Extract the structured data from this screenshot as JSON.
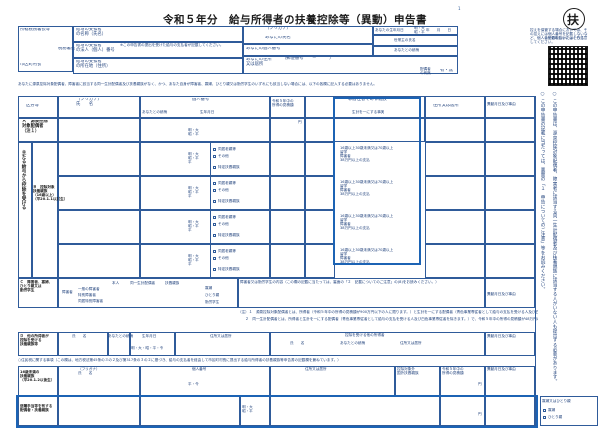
{
  "header": {
    "title": "令和５年分　給与所得者の扶養控除等（異動）申告書",
    "page_no": "1",
    "circle_badge": "扶"
  },
  "employer": {
    "tax_office": "所轄税務署長等",
    "office_suffix": "税務署長",
    "city_suffix": "市区町村長",
    "payer_name": "給与の支払者\nの名称（氏名）",
    "payer_number": "給与の支払者\nの法人（個人）番号",
    "payer_address": "給与の支払者\nの所在地（住所）",
    "number_note": "※この申告書の提出を受けた給与の支払者が記載してください。"
  },
  "applicant": {
    "kana_label": "（フリガナ）",
    "name_label": "あなたの氏名",
    "number_label": "あなたの個人番号",
    "address_label": "あなたの住所\n又は居所",
    "postal_label": "（郵便番号　　－　　　）",
    "birth_label": "あなたの生年月日",
    "birth_value": "明・大\n昭・平",
    "birth_ymd": "年　　月　　日",
    "householder_label": "世帯主の氏名",
    "relation_label": "あなたとの続柄",
    "spouse_label": "配偶者\nの有無",
    "spouse_value": "有・無"
  },
  "notice": "あなたに源泉控除対象配偶者、障害者に該当する同一生計配偶者及び扶養親族がなく、かつ、あなた自身が障害者、寡婦、ひとり親又は勤労学生のいずれにも該当しない場合には、以下の各欄に記入する必要はありません。",
  "side_panel": {
    "caption": "控えを保管する場合においては、その控えには個人番号を記載しないなど、個人番号の取扱いには十分注意してください。",
    "qr_caption": "記載のしかたはこちら",
    "vertical_notes": [
      "○ この申告書は、源泉控除対象配偶者、障害者に該当する同一生計配偶者及び扶養親族に該当する人がいない人も提出する必要があります。",
      "○ この申告書の記載に当たっては、裏面の「１　申告についてのご注意」等をお読みください。"
    ]
  },
  "section_main": {
    "kubun": "区分等",
    "kana_col": "（フリガナ）\n氏　　名",
    "relation_col": "あなたとの続柄",
    "number_col": "個人番号",
    "birth_col": "生年月日",
    "income_col": "令和５年中の\n所得の見積額",
    "nonresident_col": "非居住者である親族",
    "living_col": "生計を一にする事実",
    "address_col": "住所又は居所",
    "change_col": "異動月日及び事由",
    "row_a": "Ａ　源泉控除\n対象配偶者\n（注１）",
    "row_b_title": "主たる給与から控除を受ける",
    "row_b": "Ｂ　控除対象\n扶養親族\n（16歳以上）\n（平20.1.1以前生）",
    "row_c": "Ｃ　障害者、寡婦、\nひとり親又は\n勤労学生",
    "birth_era": "明・大\n昭・平",
    "birth_era2": "平・令\n昭・平",
    "birth_era_b": "明・大\n昭・平\n平",
    "income_yen": "円",
    "check_old": "同居老親等",
    "check_other": "その他",
    "check_special": "特定扶養親族",
    "nonres_opts": "16歳以上30歳未満又は70歳以上\n留学\n障害者\n38万円以上の支払",
    "living_opts": "生計を一にする事実\n（送金額）",
    "c_items": [
      "障害者",
      "一般の障害者",
      "特別障害者",
      "同居特別障害者",
      "寡婦",
      "ひとり親",
      "勤労学生"
    ],
    "c_headers": [
      "本人",
      "同一生計配偶者",
      "扶養親族"
    ],
    "c_note": "障害者又は勤労学生の内容（この欄の記載に当たっては、裏面の「２　記載についてのご注意」の(8)をお読みください。）",
    "c_change": "異動月日及び事由",
    "footnote1": "（注）１　源泉控除対象配偶者とは、所得者（令和５年中の所得の見積額が900万円以下の人に限ります。）と生計を一にする配偶者（青色事業専従者として給与の支払を受ける人及び白色事業専従者を除きます。）で、令和５年中の所得の見積額が95万円以下の人をいいます。",
    "footnote2": "　　２　同一生計配偶者とは、所得者と生計を一にする配偶者（青色事業専従者として給与の支払を受ける人及び白色事業専従者を除きます。）で、令和５年中の所得の見積額が48万円以下の人をいいます。"
  },
  "section_d": {
    "label": "Ｄ　他の所得者が\n控除を受ける\n扶養親族等",
    "name_col": "氏　　名",
    "relation_col": "あなたとの続柄",
    "birth_col": "生年月日",
    "address_col": "住所又は居所",
    "deductor_title": "控除を受ける他の所得者",
    "deductor_cols": [
      "氏　　名",
      "あなたとの続柄",
      "住所又は居所"
    ],
    "change_col": "異動月日及び事由",
    "birth_era": "明・大・昭・平・令"
  },
  "section_resident": {
    "heading": "○住民税に関する事項（この欄は、地方税法第45条の３の２及び第317条の３の２に基づき、給与の支払者を経由して市区町村長に提出する給与所得者の扶養親族等申告書の記載欄を兼ねています。）",
    "row1_label": "16歳未満の\n扶養親族\n（平20.1.2以後生）",
    "row2_label": "退職手当等を有する\n配偶者・扶養親族",
    "kana_col": "（フリガナ）\n氏　　名",
    "relation_col": "あなたとの続柄",
    "number_col": "個人番号",
    "birth_col": "生年月日",
    "address_col": "住所又は居所",
    "nonres_col": "控除対象外\n国外扶養親族",
    "income_col": "令和５年中の\n所得の見積額",
    "change_col": "異動月日及び事由",
    "birth_era": "平・令",
    "birth_era2": "明・大\n昭・平",
    "income_yen": "円",
    "widow_title": "寡婦又はひとり親",
    "widow_opts": [
      "寡婦",
      "ひとり親"
    ]
  }
}
